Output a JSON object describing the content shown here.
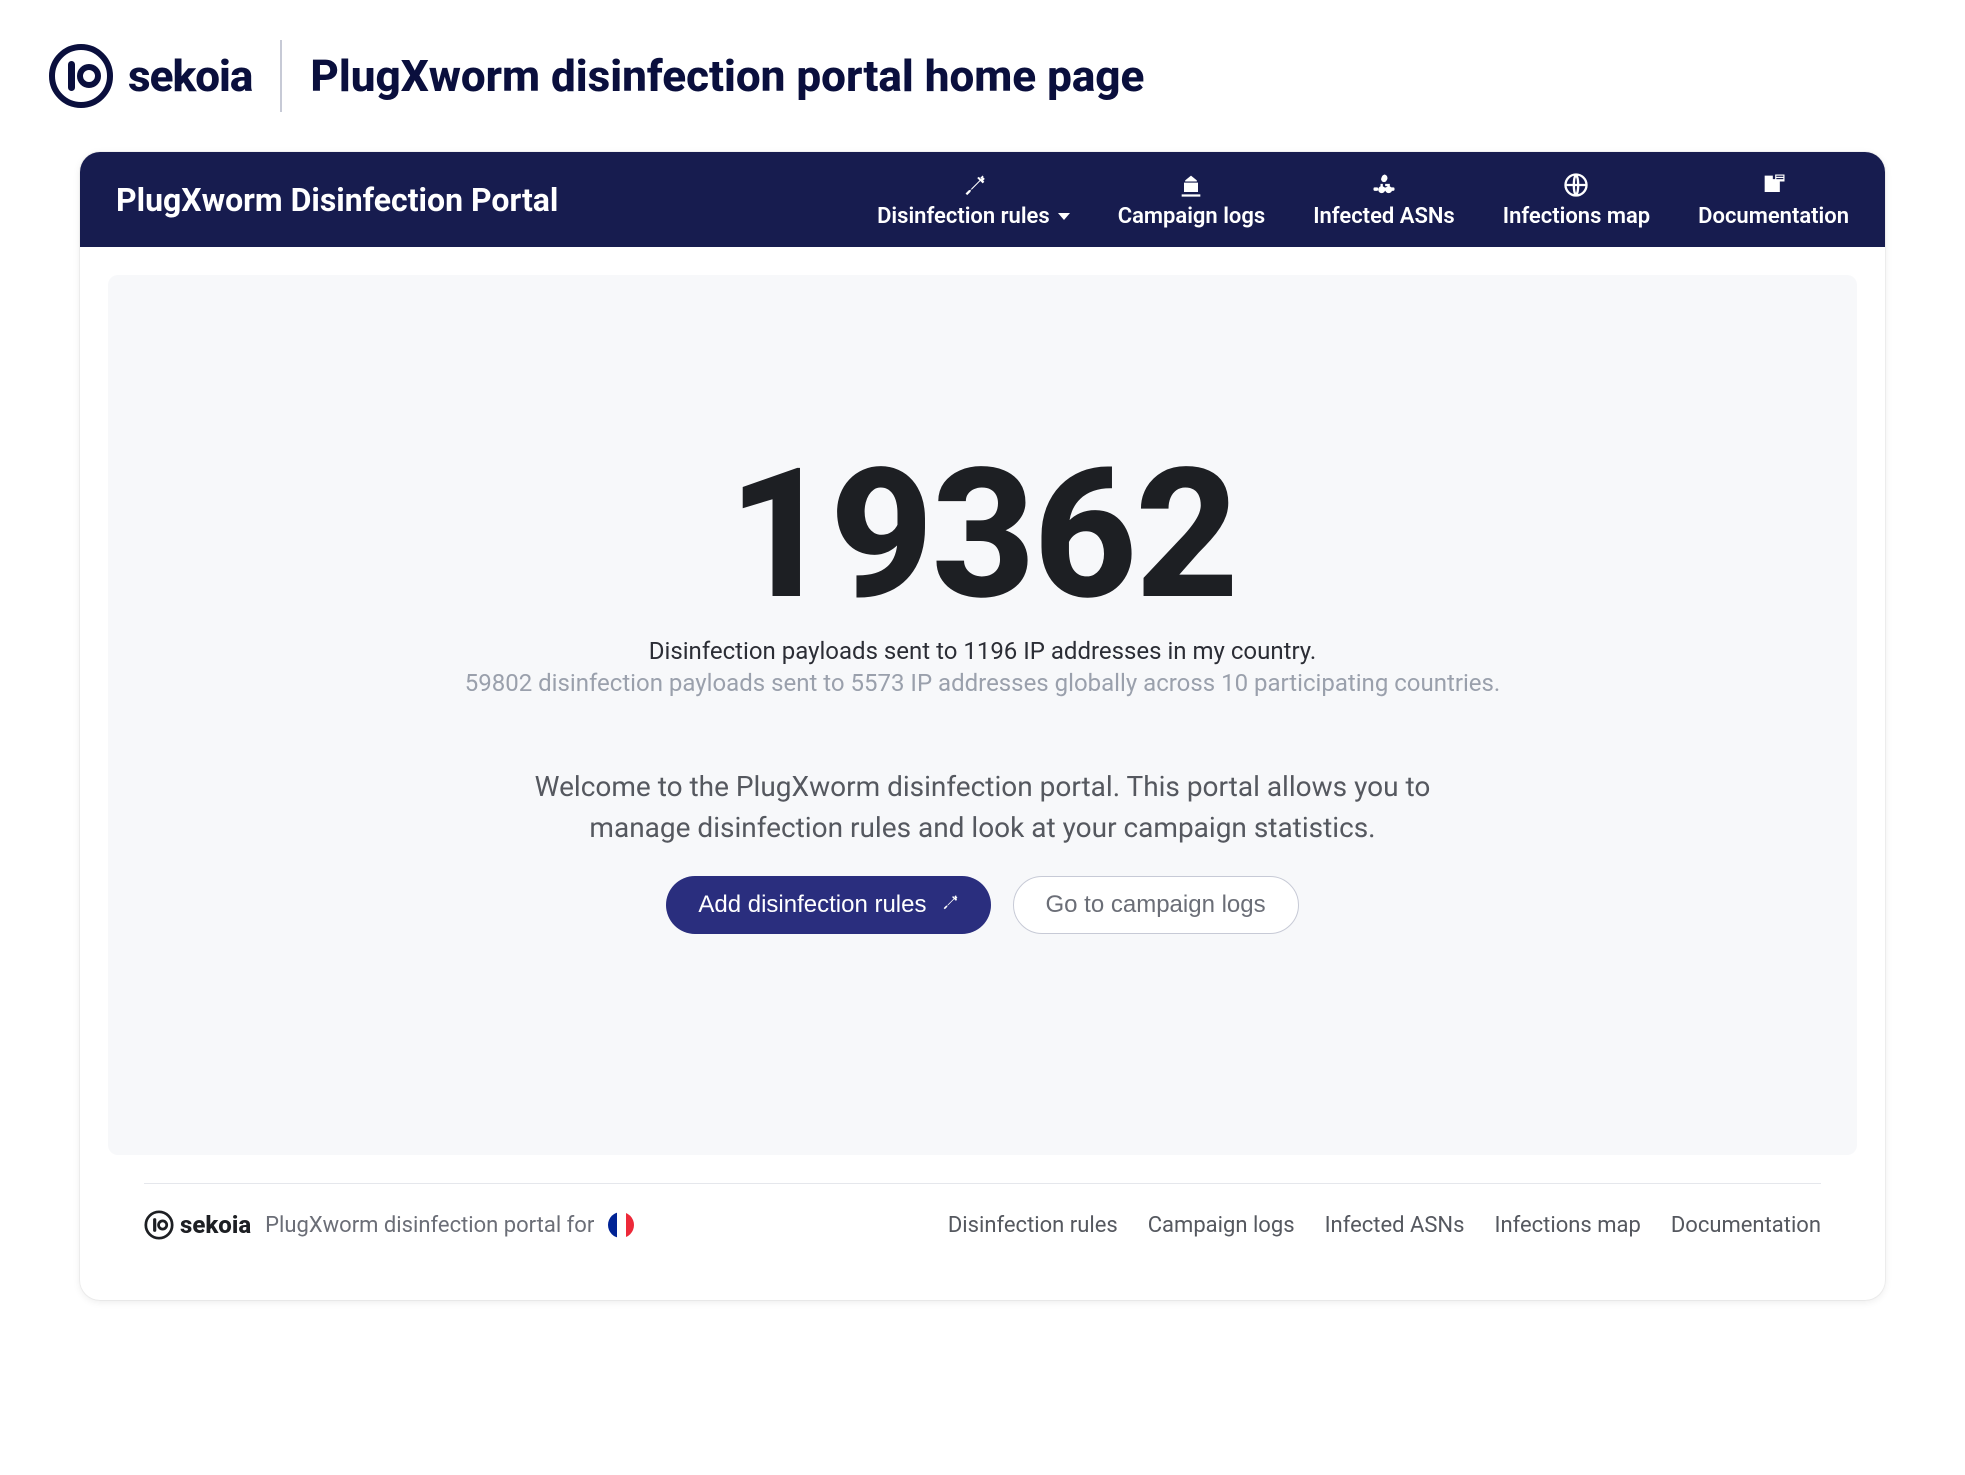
{
  "outer": {
    "brand": "sekoia",
    "title": "PlugXworm disinfection portal home page"
  },
  "navbar": {
    "title": "PlugXworm Disinfection Portal",
    "items": [
      {
        "label": "Disinfection rules",
        "icon": "syringe-icon",
        "hasDropdown": true
      },
      {
        "label": "Campaign logs",
        "icon": "building-icon",
        "hasDropdown": false
      },
      {
        "label": "Infected ASNs",
        "icon": "network-icon",
        "hasDropdown": false
      },
      {
        "label": "Infections map",
        "icon": "globe-icon",
        "hasDropdown": false
      },
      {
        "label": "Documentation",
        "icon": "docs-icon",
        "hasDropdown": false
      }
    ]
  },
  "hero": {
    "count": "19362",
    "line1": "Disinfection payloads sent to 1196 IP addresses in my country.",
    "line2": "59802 disinfection payloads sent to 5573 IP addresses globally across 10 participating countries.",
    "welcome": "Welcome to the PlugXworm disinfection portal. This portal allows you to manage disinfection rules and look at your campaign statistics.",
    "btn_primary": "Add disinfection rules",
    "btn_secondary": "Go to campaign logs"
  },
  "footer": {
    "text": "PlugXworm disinfection portal for",
    "links": [
      "Disinfection rules",
      "Campaign logs",
      "Infected ASNs",
      "Infections map",
      "Documentation"
    ]
  }
}
